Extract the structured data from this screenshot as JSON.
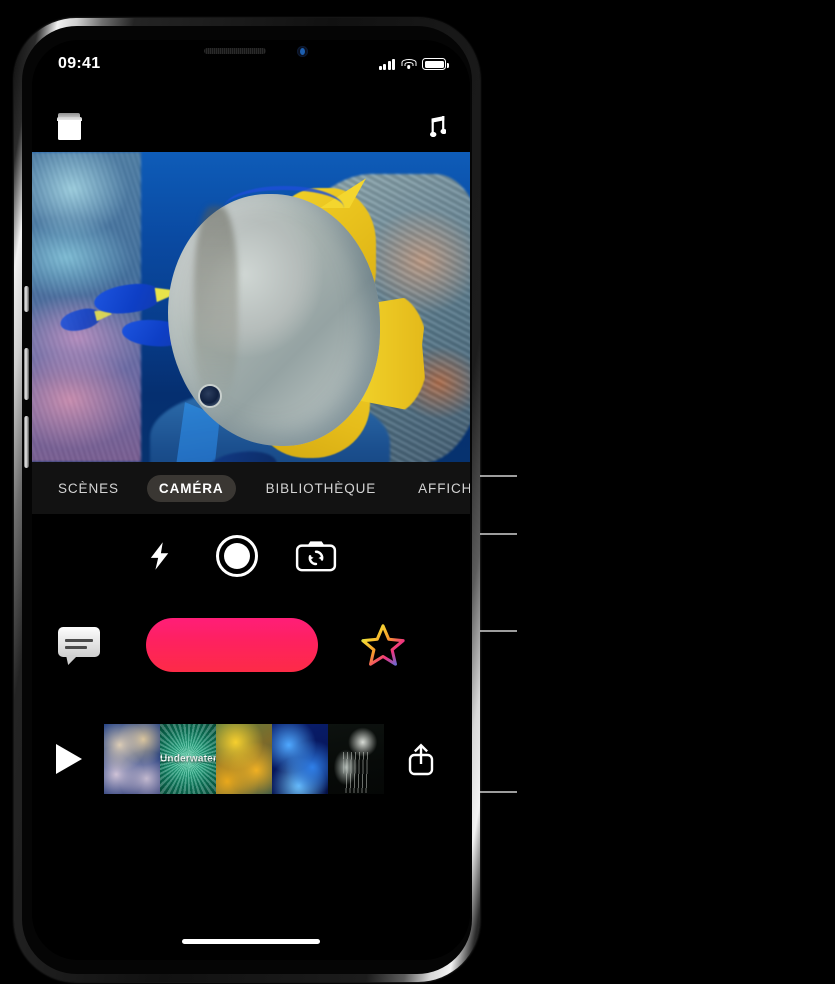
{
  "device": {
    "name": "iphone-frame",
    "side_buttons": [
      "mute-switch",
      "volume-up-button",
      "volume-down-button",
      "power-button"
    ]
  },
  "status_bar": {
    "time": "09:41",
    "cellular_icon": "cellular-signal-icon",
    "wifi_icon": "wifi-icon",
    "battery_icon": "battery-icon"
  },
  "app_topbar": {
    "projects_icon": "projects-icon",
    "music_icon": "music-note-icon"
  },
  "preview": {
    "label": "camera-video-preview",
    "scene": "underwater reef with batfish"
  },
  "tabs": [
    {
      "label": "SCÈNES",
      "name": "tab-scenes",
      "active": false
    },
    {
      "label": "CAMÉRA",
      "name": "tab-camera",
      "active": true
    },
    {
      "label": "BIBLIOTHÈQUE",
      "name": "tab-library",
      "active": false
    },
    {
      "label": "AFFICHES",
      "name": "tab-posters",
      "active": false
    }
  ],
  "camera_controls": [
    {
      "name": "flash-button",
      "icon": "flash-icon"
    },
    {
      "name": "shutter-mode-button",
      "icon": "shutter-circle-icon"
    },
    {
      "name": "flip-camera-button",
      "icon": "camera-flip-icon"
    }
  ],
  "record_row": {
    "teleprompter_icon": "teleprompter-speech-bubble-icon",
    "record_button": "record-button",
    "record_color_top": "#FF1E78",
    "record_color_bottom": "#FD2B47",
    "effects_icon": "rainbow-star-effects-icon"
  },
  "filmstrip": {
    "play_icon": "play-icon",
    "share_icon": "share-icon",
    "thumbnails": [
      {
        "name": "thumbnail-1",
        "title": ""
      },
      {
        "name": "thumbnail-2",
        "title": "Underwater"
      },
      {
        "name": "thumbnail-3",
        "title": ""
      },
      {
        "name": "thumbnail-4",
        "title": ""
      },
      {
        "name": "thumbnail-5",
        "title": ""
      }
    ]
  },
  "home_indicator": "home-indicator",
  "callouts": [
    {
      "name": "callout-camera-tab",
      "target": "CAMÉRA"
    },
    {
      "name": "callout-library-tab",
      "target": "BIBLIOTHÈQUE"
    },
    {
      "name": "callout-posters-tab",
      "target": "AFFICHES"
    },
    {
      "name": "callout-record-button",
      "target": "record-button"
    }
  ]
}
